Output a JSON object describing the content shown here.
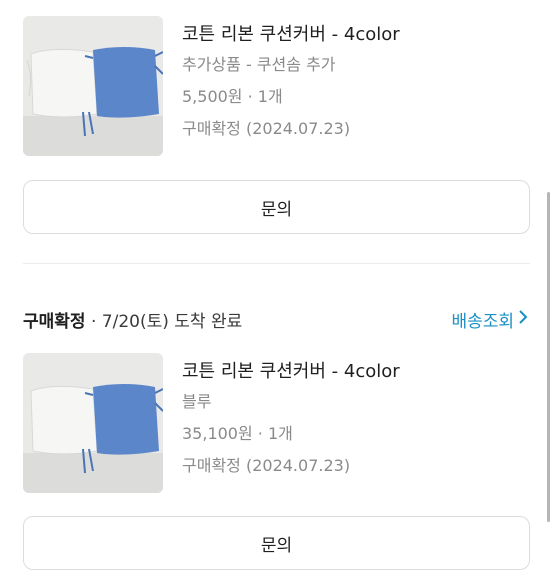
{
  "items": [
    {
      "title": "코튼 리본 쿠션커버 - 4color",
      "option": "추가상품 - 쿠션솜 추가",
      "price_qty": "5,500원 · 1개",
      "status": "구매확정 (2024.07.23)",
      "inquiry_label": "문의"
    },
    {
      "title": "코튼 리본 쿠션커버 - 4color",
      "option": "블루",
      "price_qty": "35,100원 · 1개",
      "status": "구매확정 (2024.07.23)",
      "inquiry_label": "문의"
    }
  ],
  "order": {
    "status": "구매확정",
    "info": " · 7/20(토) 도착 완료",
    "tracking_label": "배송조회",
    "tracking_icon": "chevron-right-icon"
  },
  "colors": {
    "accent": "#1a8fc4",
    "pillow_blue": "#5b86c9",
    "pillow_white": "#f4f4f2"
  }
}
